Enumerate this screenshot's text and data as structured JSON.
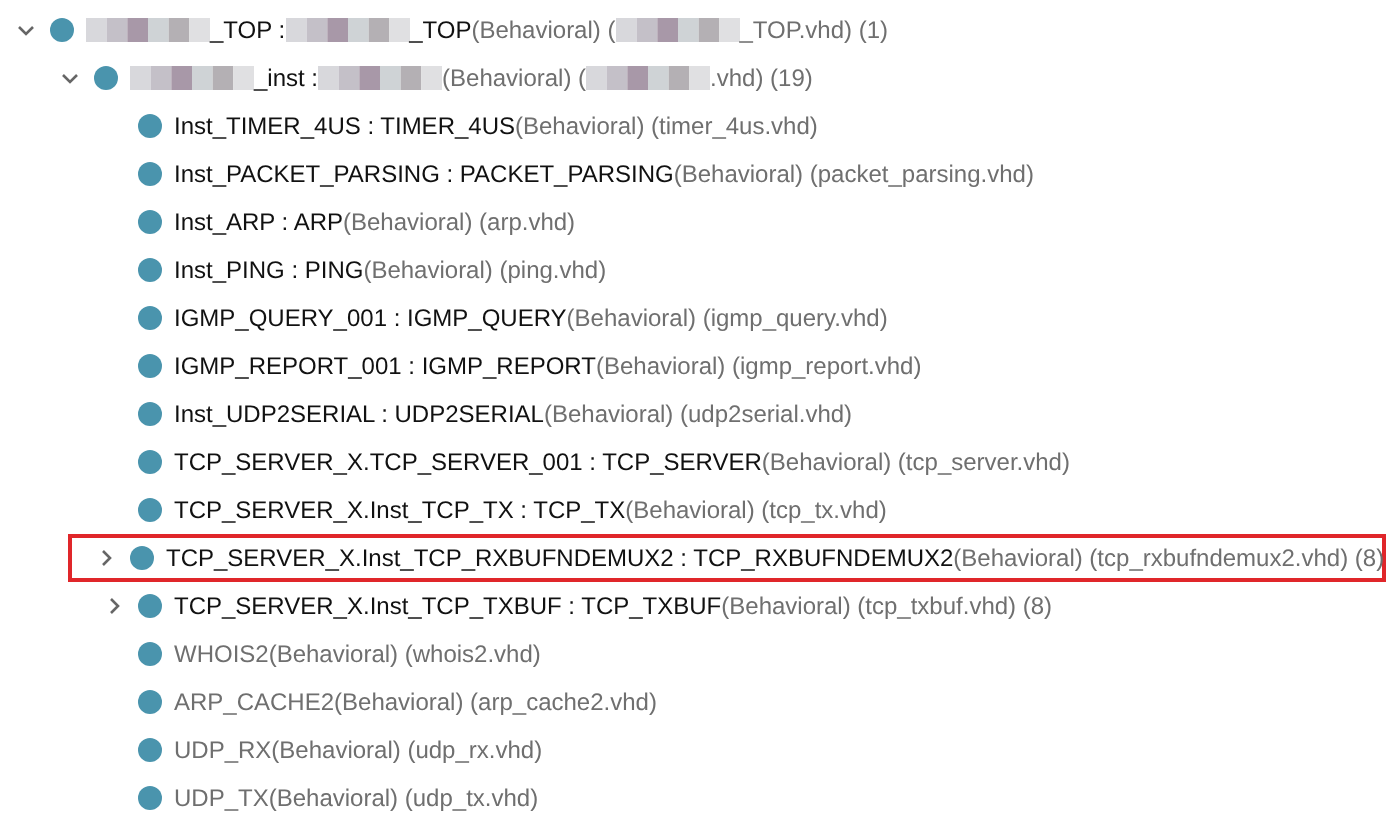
{
  "tree": [
    {
      "kind": "expanded",
      "selected": false,
      "parts": [
        {
          "kind": "redacted"
        },
        {
          "kind": "name",
          "text": "_TOP : "
        },
        {
          "kind": "redacted"
        },
        {
          "kind": "name",
          "text": "_TOP"
        },
        {
          "kind": "info",
          "text": "(Behavioral) ("
        },
        {
          "kind": "redacted"
        },
        {
          "kind": "info",
          "text": "_TOP.vhd) (1)"
        }
      ],
      "children": [
        {
          "kind": "expanded",
          "selected": false,
          "parts": [
            {
              "kind": "redacted"
            },
            {
              "kind": "name",
              "text": "_inst : "
            },
            {
              "kind": "redacted"
            },
            {
              "kind": "info",
              "text": "(Behavioral) ("
            },
            {
              "kind": "redacted"
            },
            {
              "kind": "info",
              "text": ".vhd) (19)"
            }
          ],
          "children": [
            {
              "kind": "leaf",
              "selected": false,
              "parts": [
                {
                  "kind": "name",
                  "text": "Inst_TIMER_4US : TIMER_4US"
                },
                {
                  "kind": "info",
                  "text": "(Behavioral) (timer_4us.vhd)"
                }
              ]
            },
            {
              "kind": "leaf",
              "selected": false,
              "parts": [
                {
                  "kind": "name",
                  "text": "Inst_PACKET_PARSING : PACKET_PARSING"
                },
                {
                  "kind": "info",
                  "text": "(Behavioral) (packet_parsing.vhd)"
                }
              ]
            },
            {
              "kind": "leaf",
              "selected": false,
              "parts": [
                {
                  "kind": "name",
                  "text": "Inst_ARP : ARP"
                },
                {
                  "kind": "info",
                  "text": "(Behavioral) (arp.vhd)"
                }
              ]
            },
            {
              "kind": "leaf",
              "selected": false,
              "parts": [
                {
                  "kind": "name",
                  "text": "Inst_PING : PING"
                },
                {
                  "kind": "info",
                  "text": "(Behavioral) (ping.vhd)"
                }
              ]
            },
            {
              "kind": "leaf",
              "selected": false,
              "parts": [
                {
                  "kind": "name",
                  "text": "IGMP_QUERY_001 : IGMP_QUERY"
                },
                {
                  "kind": "info",
                  "text": "(Behavioral) (igmp_query.vhd)"
                }
              ]
            },
            {
              "kind": "leaf",
              "selected": false,
              "parts": [
                {
                  "kind": "name",
                  "text": "IGMP_REPORT_001 : IGMP_REPORT"
                },
                {
                  "kind": "info",
                  "text": "(Behavioral) (igmp_report.vhd)"
                }
              ]
            },
            {
              "kind": "leaf",
              "selected": false,
              "parts": [
                {
                  "kind": "name",
                  "text": "Inst_UDP2SERIAL : UDP2SERIAL"
                },
                {
                  "kind": "info",
                  "text": "(Behavioral) (udp2serial.vhd)"
                }
              ]
            },
            {
              "kind": "leaf",
              "selected": false,
              "parts": [
                {
                  "kind": "name",
                  "text": "TCP_SERVER_X.TCP_SERVER_001 : TCP_SERVER"
                },
                {
                  "kind": "info",
                  "text": "(Behavioral) (tcp_server.vhd)"
                }
              ]
            },
            {
              "kind": "leaf",
              "selected": false,
              "parts": [
                {
                  "kind": "name",
                  "text": "TCP_SERVER_X.Inst_TCP_TX : TCP_TX"
                },
                {
                  "kind": "info",
                  "text": "(Behavioral) (tcp_tx.vhd)"
                }
              ]
            },
            {
              "kind": "collapsed",
              "selected": true,
              "parts": [
                {
                  "kind": "name",
                  "text": "TCP_SERVER_X.Inst_TCP_RXBUFNDEMUX2 : TCP_RXBUFNDEMUX2"
                },
                {
                  "kind": "info",
                  "text": "(Behavioral) (tcp_rxbufndemux2.vhd) (8)"
                }
              ]
            },
            {
              "kind": "collapsed",
              "selected": false,
              "parts": [
                {
                  "kind": "name",
                  "text": "TCP_SERVER_X.Inst_TCP_TXBUF : TCP_TXBUF"
                },
                {
                  "kind": "info",
                  "text": "(Behavioral) (tcp_txbuf.vhd) (8)"
                }
              ]
            },
            {
              "kind": "leaf",
              "selected": false,
              "parts": [
                {
                  "kind": "info",
                  "text": "WHOIS2(Behavioral) (whois2.vhd)"
                }
              ]
            },
            {
              "kind": "leaf",
              "selected": false,
              "parts": [
                {
                  "kind": "info",
                  "text": "ARP_CACHE2(Behavioral) (arp_cache2.vhd)"
                }
              ]
            },
            {
              "kind": "leaf",
              "selected": false,
              "parts": [
                {
                  "kind": "info",
                  "text": "UDP_RX(Behavioral) (udp_rx.vhd)"
                }
              ]
            },
            {
              "kind": "leaf",
              "selected": false,
              "parts": [
                {
                  "kind": "info",
                  "text": "UDP_TX(Behavioral) (udp_tx.vhd)"
                }
              ]
            }
          ]
        }
      ]
    }
  ]
}
